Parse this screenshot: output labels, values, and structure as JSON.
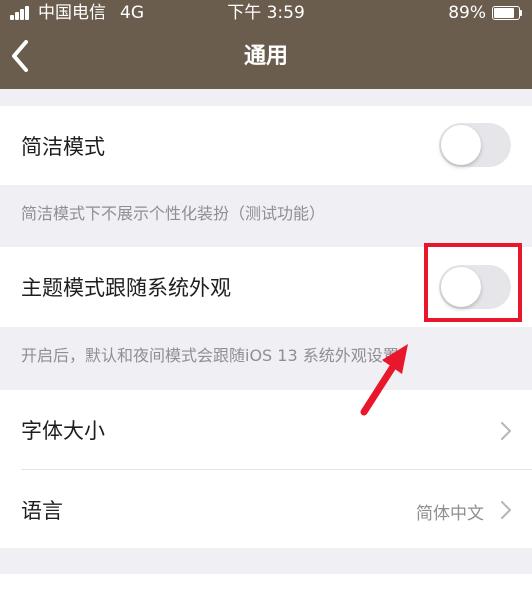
{
  "status_bar": {
    "carrier": "中国电信",
    "network": "4G",
    "time": "下午 3:59",
    "battery_percent": "89%",
    "battery_level": 0.89
  },
  "nav": {
    "back_icon": "chevron-left-icon",
    "title": "通用"
  },
  "settings": {
    "simple_mode": {
      "label": "简洁模式",
      "enabled": false
    },
    "simple_mode_caption": "简洁模式下不展示个性化装扮（测试功能）",
    "theme_follow_system": {
      "label": "主题模式跟随系统外观",
      "enabled": false
    },
    "theme_caption": "开启后，默认和夜间模式会跟随iOS 13 系统外观设置",
    "font_size": {
      "label": "字体大小"
    },
    "language": {
      "label": "语言",
      "value": "简体中文"
    }
  },
  "annotation": {
    "color": "#e8172c"
  },
  "colors": {
    "header": "#6b5d4e",
    "background": "#efeff4",
    "toggle_off": "#e6e6ea"
  }
}
